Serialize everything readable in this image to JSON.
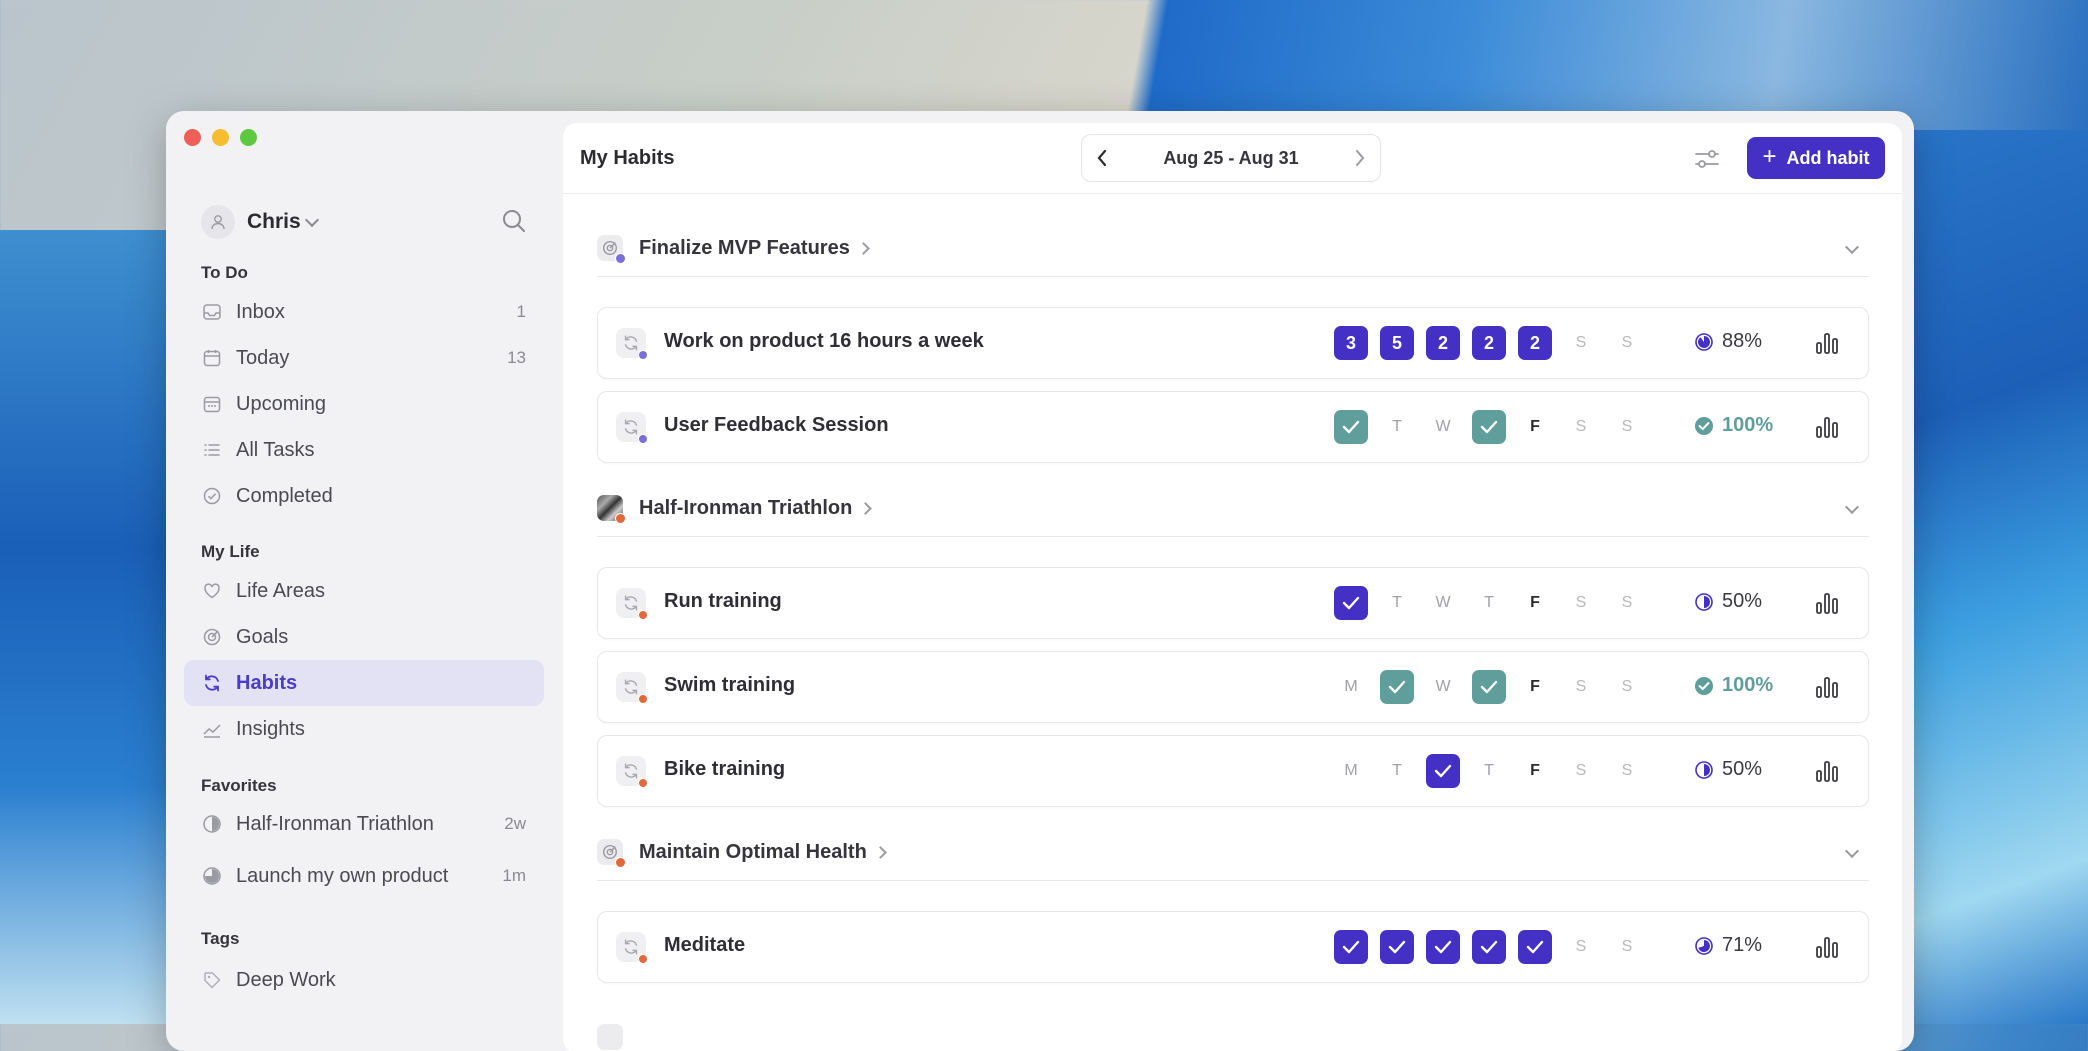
{
  "sidebar": {
    "user": {
      "name": "Chris"
    },
    "todo": {
      "title": "To Do",
      "items": [
        {
          "label": "Inbox",
          "count": "1",
          "icon": "inbox-icon"
        },
        {
          "label": "Today",
          "count": "13",
          "icon": "calendar-icon"
        },
        {
          "label": "Upcoming",
          "count": "",
          "icon": "calendar-upcoming-icon"
        },
        {
          "label": "All Tasks",
          "count": "",
          "icon": "list-icon"
        },
        {
          "label": "Completed",
          "count": "",
          "icon": "check-circle-icon"
        }
      ]
    },
    "life": {
      "title": "My Life",
      "items": [
        {
          "label": "Life Areas",
          "icon": "heart-icon"
        },
        {
          "label": "Goals",
          "icon": "target-icon"
        },
        {
          "label": "Habits",
          "icon": "refresh-icon",
          "active": true
        },
        {
          "label": "Insights",
          "icon": "chart-line-icon"
        }
      ]
    },
    "favorites": {
      "title": "Favorites",
      "items": [
        {
          "label": "Half-Ironman Triathlon",
          "count": "2w",
          "progress": 0.5
        },
        {
          "label": "Launch my own product",
          "count": "1m",
          "progress": 0.75
        }
      ]
    },
    "tags": {
      "title": "Tags",
      "items": [
        {
          "label": "Deep Work",
          "icon": "tag-icon"
        }
      ]
    }
  },
  "header": {
    "title": "My Habits",
    "date_range": "Aug 25 - Aug 31",
    "add_label": "Add habit"
  },
  "groups": [
    {
      "title": "Finalize MVP Features",
      "dot_color": "#7b6fd6",
      "habits": [
        {
          "name": "Work on product 16 hours a week",
          "days": [
            "3",
            "5",
            "2",
            "2",
            "2",
            "S",
            "S"
          ],
          "progress": "88%",
          "progress_fraction": 0.88
        },
        {
          "name": "User Feedback Session",
          "days": [
            "check-teal",
            "T",
            "W",
            "check-teal",
            "F",
            "S",
            "S"
          ],
          "progress": "100%",
          "progress_fraction": 1.0
        }
      ]
    },
    {
      "title": "Half-Ironman Triathlon",
      "dot_color": "#e2683c",
      "habits": [
        {
          "name": "Run training",
          "days": [
            "check-purple",
            "T",
            "W",
            "T",
            "F",
            "S",
            "S"
          ],
          "progress": "50%",
          "progress_fraction": 0.5
        },
        {
          "name": "Swim training",
          "days": [
            "M",
            "check-teal",
            "W",
            "check-teal",
            "F",
            "S",
            "S"
          ],
          "progress": "100%",
          "progress_fraction": 1.0
        },
        {
          "name": "Bike training",
          "days": [
            "M",
            "T",
            "check-purple",
            "T",
            "F",
            "S",
            "S"
          ],
          "progress": "50%",
          "progress_fraction": 0.5
        }
      ]
    },
    {
      "title": "Maintain Optimal Health",
      "dot_color": "#e2683c",
      "habits": [
        {
          "name": "Meditate",
          "days": [
            "check-purple",
            "check-purple",
            "check-purple",
            "check-purple",
            "check-purple",
            "S",
            "S"
          ],
          "progress": "71%",
          "progress_fraction": 0.71
        }
      ]
    }
  ],
  "colors": {
    "accent": "#4430c4",
    "done": "#5f9e9b",
    "active_bg": "#e3e1f4"
  }
}
